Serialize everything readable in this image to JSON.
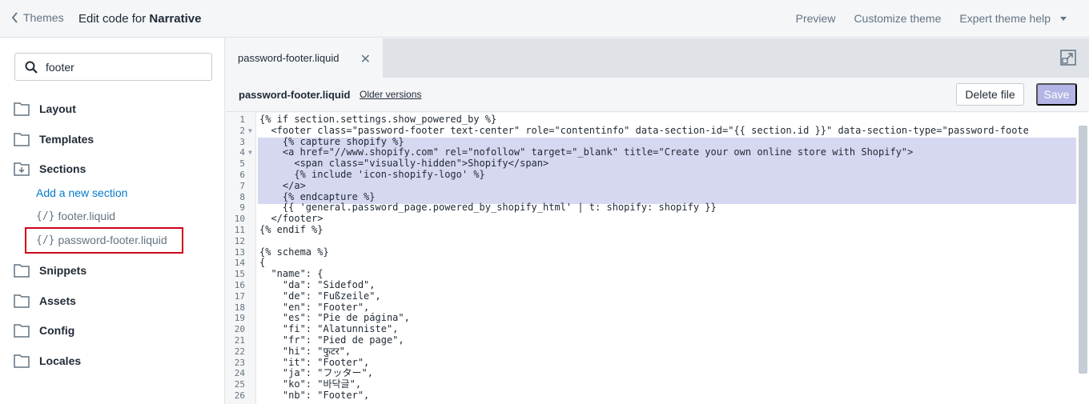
{
  "topbar": {
    "back_label": "Themes",
    "edit_prefix": "Edit code for",
    "theme_name": "Narrative",
    "nav": [
      "Preview",
      "Customize theme",
      "Expert theme help"
    ]
  },
  "sidebar": {
    "search_value": "footer",
    "folders": [
      "Layout",
      "Templates",
      "Sections",
      "Snippets",
      "Assets",
      "Config",
      "Locales"
    ],
    "add_section_label": "Add a new section",
    "files": [
      "footer.liquid",
      "password-footer.liquid"
    ]
  },
  "editor": {
    "tab_label": "password-footer.liquid",
    "file_name": "password-footer.liquid",
    "older_versions_label": "Older versions",
    "delete_label": "Delete file",
    "save_label": "Save",
    "code_lines": [
      {
        "n": "1",
        "t": "{% if section.settings.show_powered_by %}"
      },
      {
        "n": "2",
        "t": "  <footer class=\"password-footer text-center\" role=\"contentinfo\" data-section-id=\"{{ section.id }}\" data-section-type=\"password-foote"
      },
      {
        "n": "3",
        "t": "    {% capture shopify %}"
      },
      {
        "n": "4",
        "t": "    <a href=\"//www.shopify.com\" rel=\"nofollow\" target=\"_blank\" title=\"Create your own online store with Shopify\">"
      },
      {
        "n": "5",
        "t": "      <span class=\"visually-hidden\">Shopify</span>"
      },
      {
        "n": "6",
        "t": "      {% include 'icon-shopify-logo' %}"
      },
      {
        "n": "7",
        "t": "    </a>"
      },
      {
        "n": "8",
        "t": "    {% endcapture %}"
      },
      {
        "n": "9",
        "t": "    {{ 'general.password_page.powered_by_shopify_html' | t: shopify: shopify }}"
      },
      {
        "n": "10",
        "t": "  </footer>"
      },
      {
        "n": "11",
        "t": "{% endif %}"
      },
      {
        "n": "12",
        "t": ""
      },
      {
        "n": "13",
        "t": "{% schema %}"
      },
      {
        "n": "14",
        "t": "{"
      },
      {
        "n": "15",
        "t": "  \"name\": {"
      },
      {
        "n": "16",
        "t": "    \"da\": \"Sidefod\","
      },
      {
        "n": "17",
        "t": "    \"de\": \"Fußzeile\","
      },
      {
        "n": "18",
        "t": "    \"en\": \"Footer\","
      },
      {
        "n": "19",
        "t": "    \"es\": \"Pie de página\","
      },
      {
        "n": "20",
        "t": "    \"fi\": \"Alatunniste\","
      },
      {
        "n": "21",
        "t": "    \"fr\": \"Pied de page\","
      },
      {
        "n": "22",
        "t": "    \"hi\": \"फुटर\","
      },
      {
        "n": "23",
        "t": "    \"it\": \"Footer\","
      },
      {
        "n": "24",
        "t": "    \"ja\": \"フッター\","
      },
      {
        "n": "25",
        "t": "    \"ko\": \"바닥글\","
      },
      {
        "n": "26",
        "t": "    \"nb\": \"Footer\","
      }
    ]
  }
}
